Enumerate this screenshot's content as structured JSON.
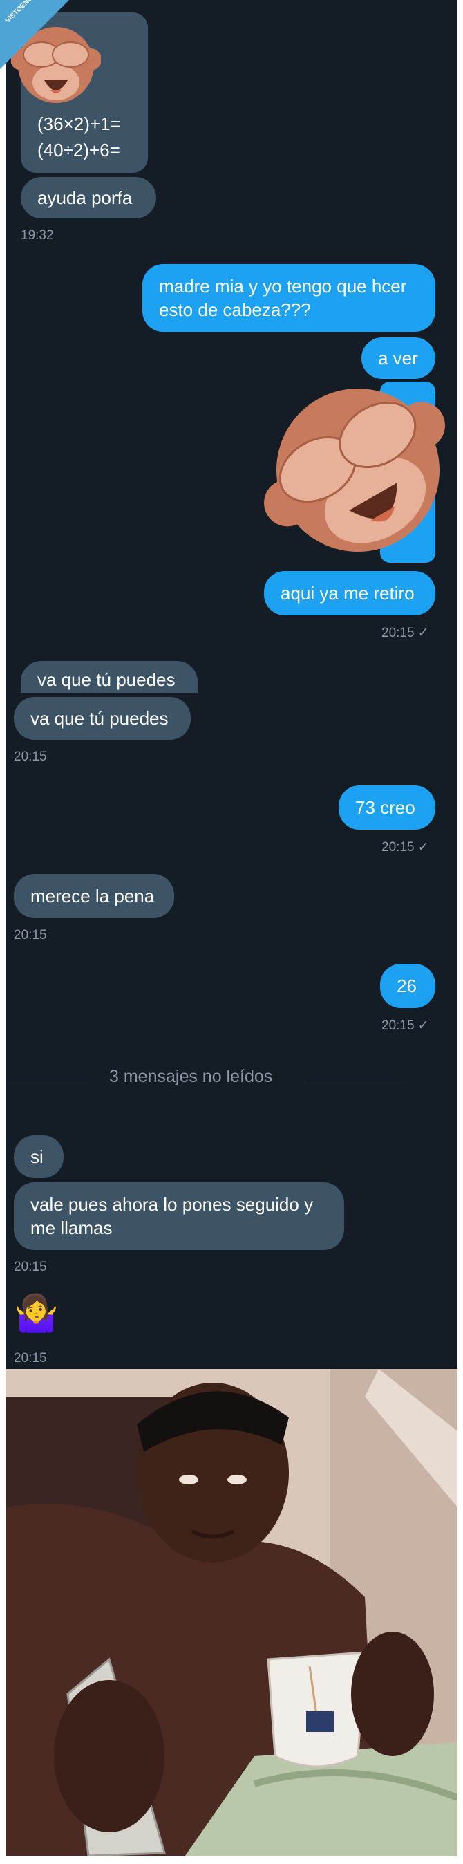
{
  "watermark": {
    "text": "VISTOENLASREDES"
  },
  "conversation": {
    "top_math": {
      "line1": "(36×2)+1=",
      "line2": "(40÷2)+6="
    },
    "msg_ayuda": "ayuda porfa",
    "ts_1932": "19:32",
    "msg_madre": "madre mia y yo tengo que hcer esto de cabeza???",
    "msg_aver": "a ver",
    "msg_retiro": "aqui ya me retiro",
    "ts_out_1": "20:15",
    "msg_vaque_hidden": "va que tú puedes",
    "msg_vaque": "va que tú puedes",
    "ts_in_1": "20:15",
    "msg_73": "73 creo",
    "ts_out_2": "20:15",
    "msg_merece": "merece la pena",
    "ts_in_2": "20:15",
    "msg_26": "26",
    "ts_out_3": "20:15",
    "unread_divider": "3 mensajes no leídos",
    "msg_si": "si",
    "msg_vale": "vale pues ahora lo pones seguido y me llamas",
    "ts_in_3": "20:15",
    "emoji_shrug": "🤷‍♀️",
    "ts_in_4": "20:15",
    "check_mark": "✓"
  },
  "colors": {
    "background": "#141d26",
    "incoming_bubble": "#3d5466",
    "outgoing_bubble": "#1da1f2",
    "timestamp": "#8b98a5",
    "monkey": "#c87a5c"
  },
  "icons": [
    "see-no-evil-monkey-icon",
    "shrug-emoji-icon",
    "check-icon"
  ]
}
